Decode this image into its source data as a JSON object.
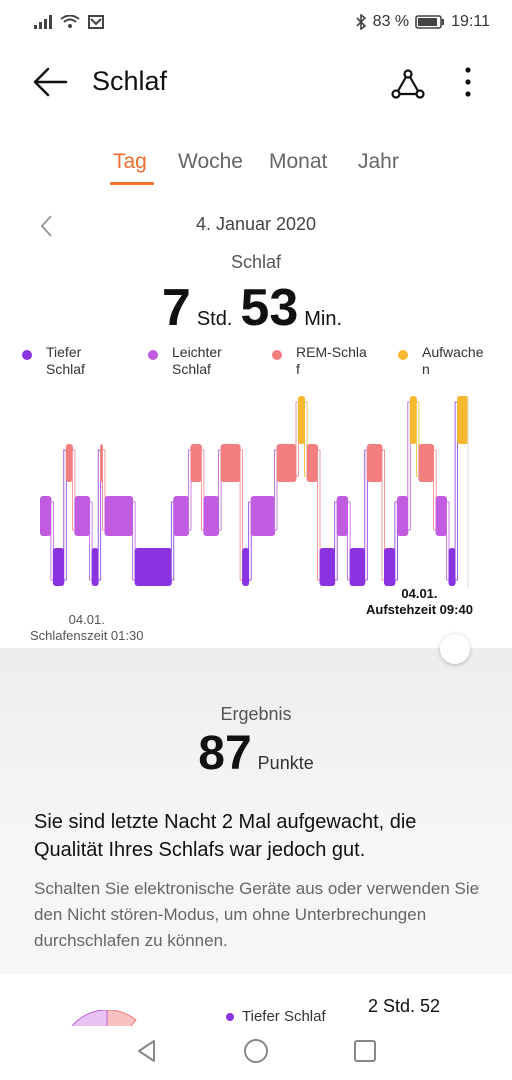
{
  "status_bar": {
    "battery_percent": "83 %",
    "time": "19:11",
    "icons": [
      "signal-icon",
      "wifi-icon",
      "mail-icon",
      "bluetooth-icon",
      "battery-icon"
    ]
  },
  "app_bar": {
    "title": "Schlaf",
    "icons": [
      "back-arrow-icon",
      "share-icon",
      "more-vertical-icon"
    ]
  },
  "tabs": [
    {
      "label": "Tag",
      "active": true
    },
    {
      "label": "Woche",
      "active": false
    },
    {
      "label": "Monat",
      "active": false
    },
    {
      "label": "Jahr",
      "active": false
    }
  ],
  "date": "4. Januar 2020",
  "sleep": {
    "caption": "Schlaf",
    "hours": "7",
    "hours_unit": "Std.",
    "minutes": "53",
    "minutes_unit": "Min."
  },
  "legend": [
    {
      "label": "Tiefer\nSchlaf",
      "color": "#8a33e0"
    },
    {
      "label": "Leichter\nSchlaf",
      "color": "#c15ce0"
    },
    {
      "label": "REM-Schla\nf",
      "color": "#f27e80"
    },
    {
      "label": "Aufwache\nn",
      "color": "#f5b82e"
    }
  ],
  "chart_data": {
    "type": "bar",
    "title": "",
    "x_range": [
      "01:30",
      "09:40"
    ],
    "y_categories": [
      "Tiefer Schlaf",
      "Leichter Schlaf",
      "REM-Schlaf",
      "Aufwachen"
    ],
    "colors": {
      "Tiefer Schlaf": "#8a33e0",
      "Leichter Schlaf": "#c15ce0",
      "REM-Schlaf": "#f27e80",
      "Aufwachen": "#f5b82e"
    },
    "segments": [
      {
        "stage": "Leichter Schlaf",
        "start": 0.0,
        "end": 0.03
      },
      {
        "stage": "Tiefer Schlaf",
        "start": 0.03,
        "end": 0.06
      },
      {
        "stage": "REM-Schlaf",
        "start": 0.06,
        "end": 0.08
      },
      {
        "stage": "Leichter Schlaf",
        "start": 0.08,
        "end": 0.12
      },
      {
        "stage": "Tiefer Schlaf",
        "start": 0.12,
        "end": 0.14
      },
      {
        "stage": "REM-Schlaf",
        "start": 0.14,
        "end": 0.15
      },
      {
        "stage": "Leichter Schlaf",
        "start": 0.15,
        "end": 0.22
      },
      {
        "stage": "Tiefer Schlaf",
        "start": 0.22,
        "end": 0.31
      },
      {
        "stage": "Leichter Schlaf",
        "start": 0.31,
        "end": 0.35
      },
      {
        "stage": "REM-Schlaf",
        "start": 0.35,
        "end": 0.38
      },
      {
        "stage": "Leichter Schlaf",
        "start": 0.38,
        "end": 0.42
      },
      {
        "stage": "REM-Schlaf",
        "start": 0.42,
        "end": 0.47
      },
      {
        "stage": "Tiefer Schlaf",
        "start": 0.47,
        "end": 0.49
      },
      {
        "stage": "Leichter Schlaf",
        "start": 0.49,
        "end": 0.55
      },
      {
        "stage": "REM-Schlaf",
        "start": 0.55,
        "end": 0.6
      },
      {
        "stage": "Aufwachen",
        "start": 0.6,
        "end": 0.62
      },
      {
        "stage": "REM-Schlaf",
        "start": 0.62,
        "end": 0.65
      },
      {
        "stage": "Tiefer Schlaf",
        "start": 0.65,
        "end": 0.69
      },
      {
        "stage": "Leichter Schlaf",
        "start": 0.69,
        "end": 0.72
      },
      {
        "stage": "Tiefer Schlaf",
        "start": 0.72,
        "end": 0.76
      },
      {
        "stage": "REM-Schlaf",
        "start": 0.76,
        "end": 0.8
      },
      {
        "stage": "Tiefer Schlaf",
        "start": 0.8,
        "end": 0.83
      },
      {
        "stage": "Leichter Schlaf",
        "start": 0.83,
        "end": 0.86
      },
      {
        "stage": "Aufwachen",
        "start": 0.86,
        "end": 0.88
      },
      {
        "stage": "REM-Schlaf",
        "start": 0.88,
        "end": 0.92
      },
      {
        "stage": "Leichter Schlaf",
        "start": 0.92,
        "end": 0.95
      },
      {
        "stage": "Tiefer Schlaf",
        "start": 0.95,
        "end": 0.97
      },
      {
        "stage": "Aufwachen",
        "start": 0.97,
        "end": 1.0
      }
    ]
  },
  "chart_labels": {
    "start_date": "04.01.",
    "start_text": "Schlafenszeit 01:30",
    "end_date": "04.01.",
    "end_text": "Aufstehzeit 09:40"
  },
  "result": {
    "caption": "Ergebnis",
    "score": "87",
    "score_unit": "Punkte",
    "summary": "Sie sind letzte Nacht 2 Mal aufgewacht, die Qualität Ihres Schlafs war jedoch gut.",
    "advice": "Schalten Sie elektronische Geräte aus oder verwenden Sie den Nicht stören-Modus, um ohne Unterbrechungen durchschlafen zu können."
  },
  "breakdown": {
    "legend_label": "Tiefer Schlaf",
    "value": "2 Std. 52"
  },
  "nav_bar": {
    "icons": [
      "back-triangle-icon",
      "home-circle-icon",
      "recents-square-icon"
    ]
  }
}
